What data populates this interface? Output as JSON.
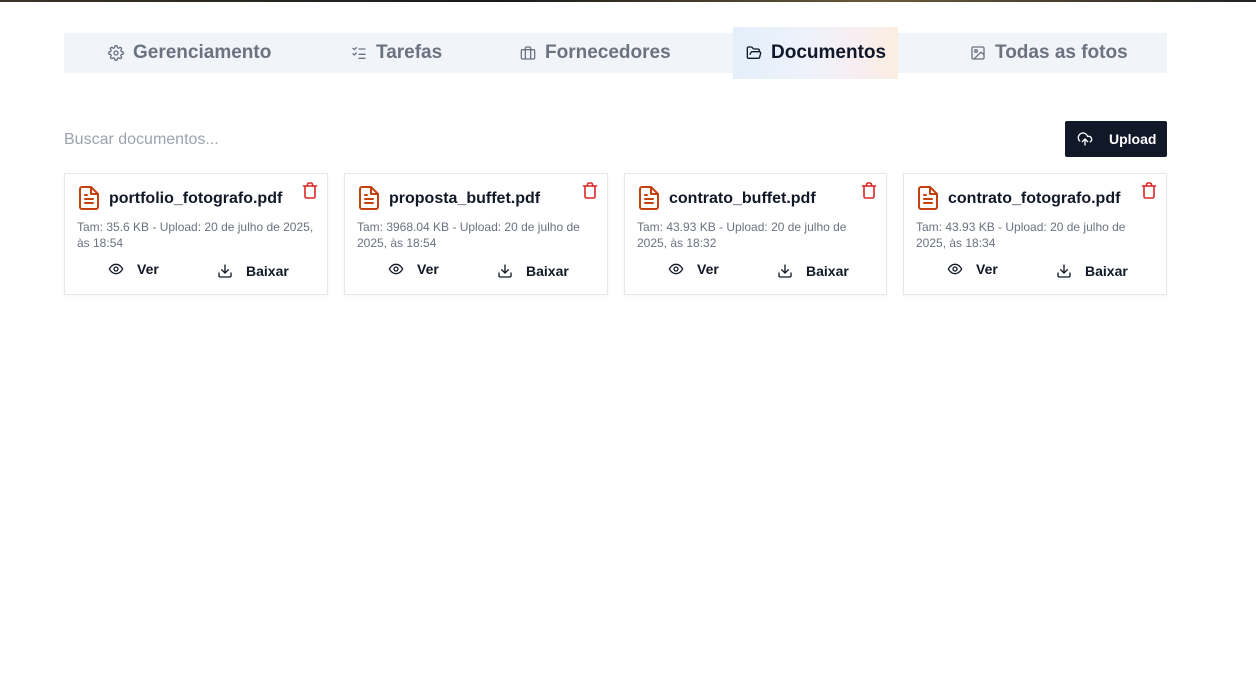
{
  "tabs": [
    {
      "label": "Gerenciamento",
      "icon": "gear-icon"
    },
    {
      "label": "Tarefas",
      "icon": "checklist-icon"
    },
    {
      "label": "Fornecedores",
      "icon": "briefcase-icon"
    },
    {
      "label": "Documentos",
      "icon": "folder-open-icon"
    },
    {
      "label": "Todas as fotos",
      "icon": "image-icon"
    }
  ],
  "active_tab": "Documentos",
  "search": {
    "placeholder": "Buscar documentos...",
    "value": ""
  },
  "upload": {
    "label": "Upload",
    "icon": "cloud-upload-icon"
  },
  "actions": {
    "view_label": "Ver",
    "download_label": "Baixar"
  },
  "colors": {
    "accent_dark": "#111827",
    "file_icon": "#c2410c",
    "trash_icon": "#dc2626"
  },
  "documents": [
    {
      "name": "portfolio_fotografo.pdf",
      "meta": "Tam: 35.6 KB - Upload: 20 de julho de 2025, às 18:54"
    },
    {
      "name": "proposta_buffet.pdf",
      "meta": "Tam: 3968.04 KB - Upload: 20 de julho de 2025, às 18:54"
    },
    {
      "name": "contrato_buffet.pdf",
      "meta": "Tam: 43.93 KB - Upload: 20 de julho de 2025, às 18:32"
    },
    {
      "name": "contrato_fotografo.pdf",
      "meta": "Tam: 43.93 KB - Upload: 20 de julho de 2025, às 18:34"
    }
  ]
}
